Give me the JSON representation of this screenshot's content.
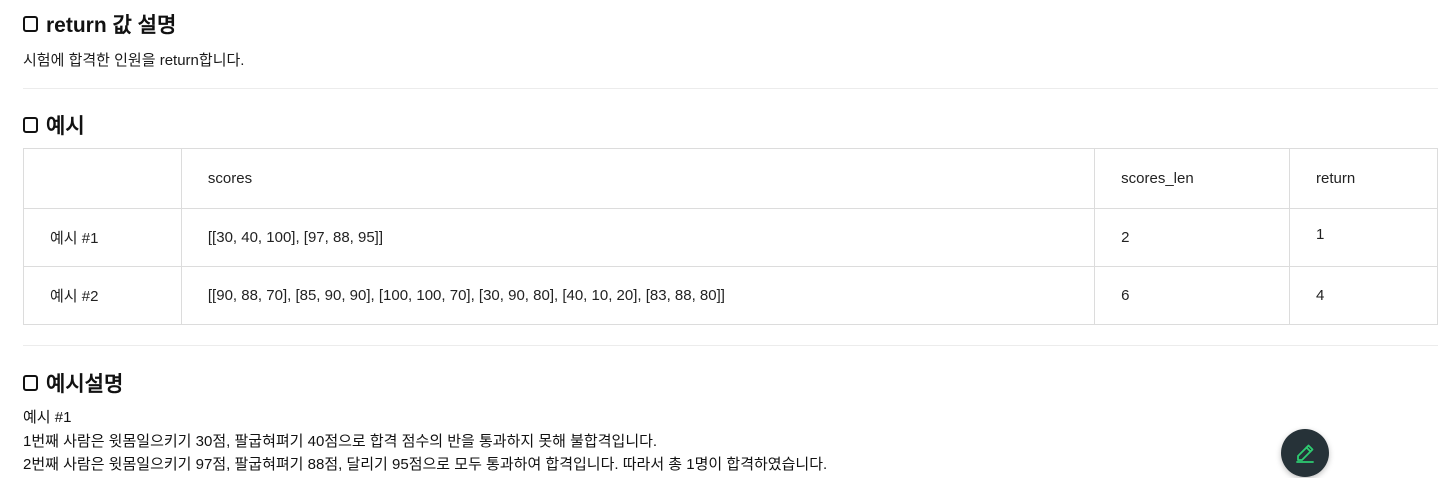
{
  "sections": {
    "return_heading": "return 값 설명",
    "return_desc": "시험에 합격한 인원을 return합니다.",
    "example_heading": "예시",
    "explain_heading": "예시설명"
  },
  "table": {
    "headers": [
      "",
      "scores",
      "scores_len",
      "return"
    ],
    "rows": [
      [
        "예시 #1",
        "[[30, 40, 100], [97, 88, 95]]",
        "2",
        "1"
      ],
      [
        "예시 #2",
        "[[90, 88, 70], [85, 90, 90], [100, 100, 70], [30, 90, 80], [40, 10, 20], [83, 88, 80]]",
        "6",
        "4"
      ]
    ]
  },
  "explanation": {
    "lines": [
      "예시 #1",
      "1번째 사람은 윗몸일으키기 30점, 팔굽혀펴기 40점으로 합격 점수의 반을 통과하지 못해 불합격입니다.",
      "2번째 사람은 윗몸일으키기 97점, 팔굽혀펴기 88점, 달리기 95점으로 모두 통과하여 합격입니다. 따라서 총 1명이 합격하였습니다."
    ]
  },
  "fab": {
    "icon": "pencil-edit-icon",
    "accent": "#2ecc71",
    "background": "#263238"
  }
}
